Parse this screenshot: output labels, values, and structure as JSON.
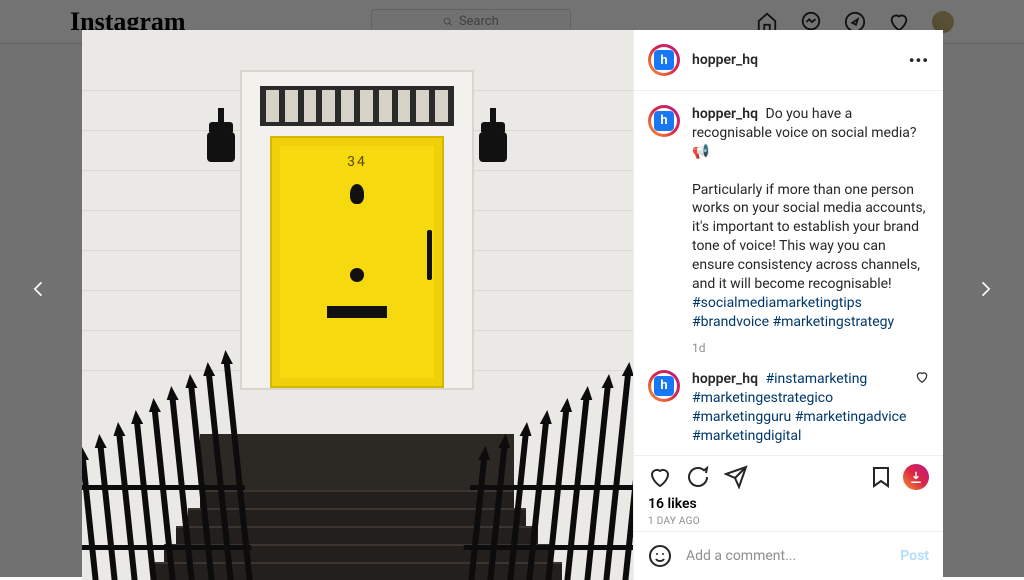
{
  "nav": {
    "logo": "Instagram",
    "search_placeholder": "Search"
  },
  "post": {
    "username": "hopper_hq",
    "door_number": "34",
    "caption_lead": "Do you have a recognisable voice on social media? 📢",
    "caption_body": "Particularly if more than one person works on your social media accounts, it's important to establish your brand tone of voice! This way you can ensure consistency across channels, and it will become recognisable!",
    "caption_tags": [
      "#socialmediamarketingtips",
      "#brandvoice",
      "#marketingstrategy"
    ],
    "caption_time": "1d",
    "comment": {
      "username": "hopper_hq",
      "tags": [
        "#instamarketing",
        "#marketingestrategico",
        "#marketingguru",
        "#marketingadvice",
        "#marketingdigital"
      ]
    },
    "likes_label": "16 likes",
    "time_label": "1 DAY AGO",
    "add_comment_placeholder": "Add a comment...",
    "post_button": "Post"
  }
}
